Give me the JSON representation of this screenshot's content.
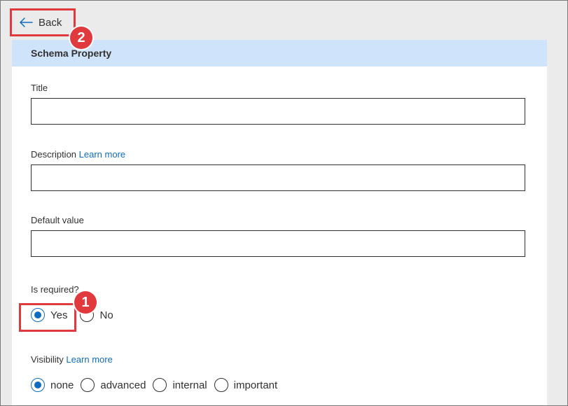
{
  "nav": {
    "back_label": "Back",
    "back_badge": "2"
  },
  "panel": {
    "title": "Schema Property"
  },
  "fields": {
    "title": {
      "label": "Title",
      "value": ""
    },
    "description": {
      "label": "Description",
      "link": "Learn more",
      "value": ""
    },
    "default_value": {
      "label": "Default value",
      "value": ""
    }
  },
  "is_required": {
    "label": "Is required?",
    "badge": "1",
    "options": [
      {
        "label": "Yes",
        "checked": true
      },
      {
        "label": "No",
        "checked": false
      }
    ]
  },
  "visibility": {
    "label": "Visibility",
    "link": "Learn more",
    "options": [
      {
        "label": "none",
        "checked": true
      },
      {
        "label": "advanced",
        "checked": false
      },
      {
        "label": "internal",
        "checked": false
      },
      {
        "label": "important",
        "checked": false
      }
    ]
  },
  "colors": {
    "accent": "#0f6cbd",
    "header_bg": "#cfe3fa",
    "highlight": "#e0393e"
  }
}
